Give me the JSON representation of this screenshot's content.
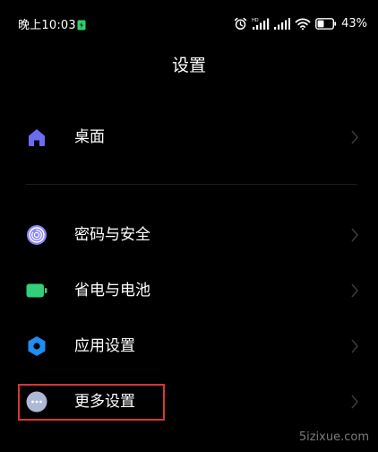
{
  "status_bar": {
    "time": "晚上10:03",
    "battery_percent": "43%",
    "battery_level": 0.43,
    "icons": [
      "charging-icon",
      "alarm-icon",
      "hd-signal-icon",
      "signal-icon",
      "wifi-icon",
      "battery-icon"
    ]
  },
  "header": {
    "title": "设置"
  },
  "settings": {
    "items": [
      {
        "label": "桌面",
        "icon": "home-icon",
        "icon_color": "#6d6cf1"
      },
      {
        "label": "密码与安全",
        "icon": "fingerprint-icon",
        "icon_color": "#8b87f5"
      },
      {
        "label": "省电与电池",
        "icon": "battery-saver-icon",
        "icon_color": "#31cf7b"
      },
      {
        "label": "应用设置",
        "icon": "gear-icon",
        "icon_color": "#1f8df2"
      },
      {
        "label": "更多设置",
        "icon": "more-icon",
        "icon_color": "#aeb9d6"
      }
    ]
  },
  "annotation": {
    "highlight_color": "#d8343c"
  },
  "watermark": "5izixue.com"
}
